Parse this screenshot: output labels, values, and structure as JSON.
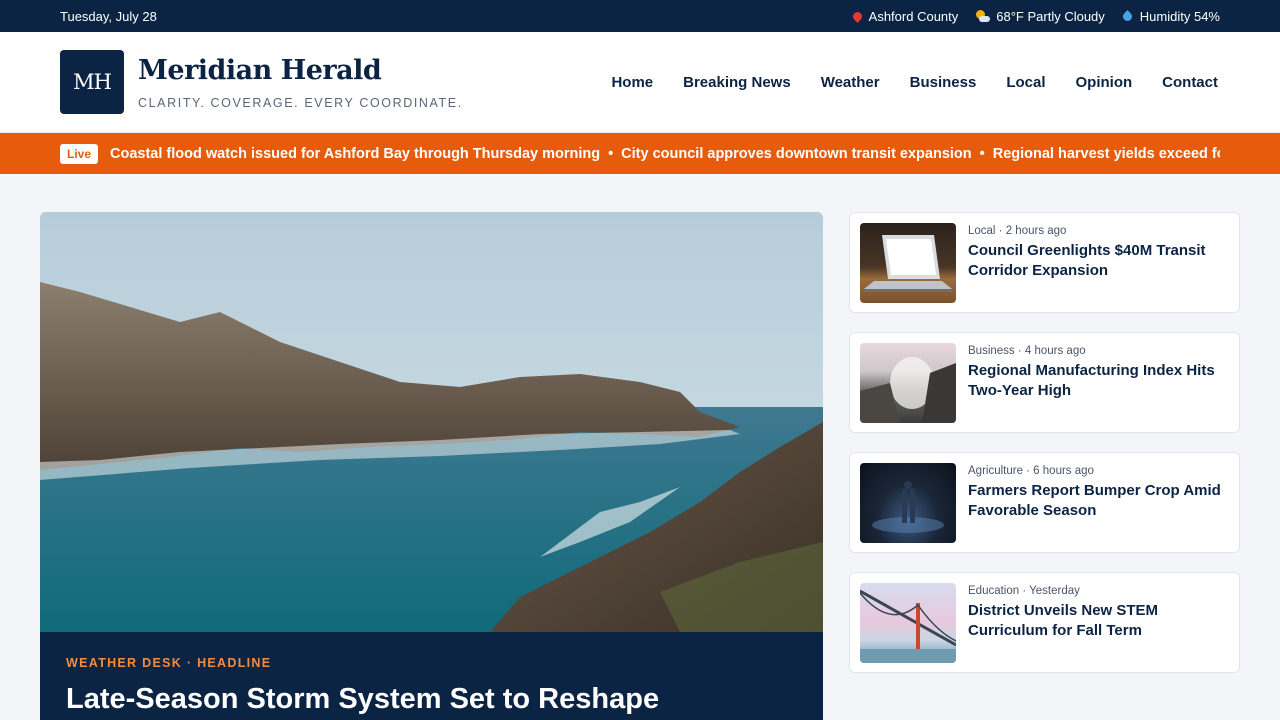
{
  "topbar": {
    "date": "Tuesday, July 28",
    "location": "Ashford County",
    "weather": "68°F Partly Cloudy",
    "humidity": "Humidity 54%"
  },
  "brand": {
    "logo_text": "MH",
    "name": "Meridian Herald",
    "tagline": "CLARITY. COVERAGE. EVERY COORDINATE."
  },
  "nav": {
    "items": [
      {
        "label": "Home"
      },
      {
        "label": "Breaking News"
      },
      {
        "label": "Weather"
      },
      {
        "label": "Business"
      },
      {
        "label": "Local"
      },
      {
        "label": "Opinion"
      },
      {
        "label": "Contact"
      }
    ]
  },
  "ticker": {
    "badge": "Live",
    "items": [
      "Coastal flood watch issued for Ashford Bay through Thursday morning",
      "City council approves downtown transit expansion",
      "Regional harvest yields exceed fore..."
    ],
    "separator": "•"
  },
  "hero": {
    "kicker": "WEATHER DESK · HEADLINE",
    "title": "Late-Season Storm System Set to Reshape"
  },
  "sidebar": {
    "cards": [
      {
        "meta": "Local · 2 hours ago",
        "title": "Council Greenlights $40M Transit Corridor Expansion"
      },
      {
        "meta": "Business · 4 hours ago",
        "title": "Regional Manufacturing Index Hits Two-Year High"
      },
      {
        "meta": "Agriculture · 6 hours ago",
        "title": "Farmers Report Bumper Crop Amid Favorable Season"
      },
      {
        "meta": "Education · Yesterday",
        "title": "District Unveils New STEM Curriculum for Fall Term"
      }
    ]
  },
  "colors": {
    "navy": "#0c2444",
    "accent_orange": "#e65c0c",
    "kicker_orange": "#f28c3c"
  }
}
